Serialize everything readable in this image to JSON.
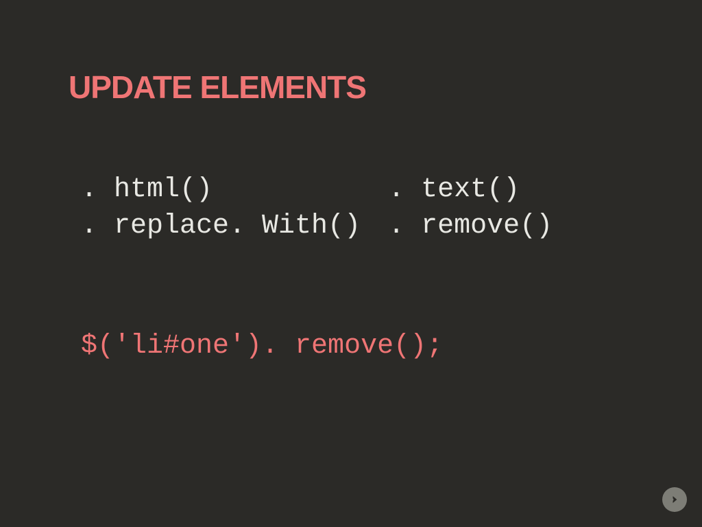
{
  "title": "UPDATE ELEMENTS",
  "methods": {
    "topLeft": ". html()",
    "topRight": ". text()",
    "bottomLeft": ". replace. With()",
    "bottomRight": ". remove()"
  },
  "codeExample": "$('li#one'). remove();"
}
